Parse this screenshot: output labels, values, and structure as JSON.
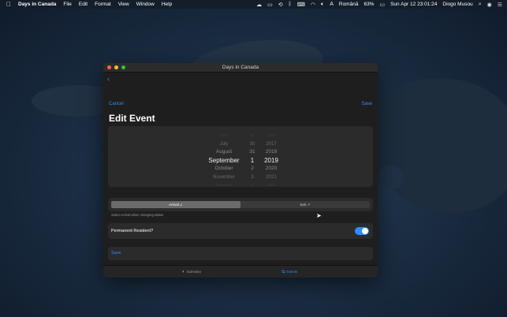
{
  "menubar": {
    "apple": "",
    "app_name": "Days in Canada",
    "menus": [
      "File",
      "Edit",
      "Format",
      "View",
      "Window",
      "Help"
    ],
    "keyboard_input": "Română",
    "battery": "63%",
    "datetime": "Sun Apr 12  23:01:24",
    "user": "Diogo Musou"
  },
  "window": {
    "title": "Days in Canada",
    "cancel_label": "Cancel",
    "save_top_label": "Save",
    "heading": "Edit Event",
    "picker": {
      "months": [
        "June",
        "July",
        "August",
        "September",
        "October",
        "November",
        "December"
      ],
      "days": [
        "29",
        "30",
        "31",
        "1",
        "2",
        "3",
        "4"
      ],
      "years": [
        "2016",
        "2017",
        "2018",
        "2019",
        "2020",
        "2021",
        "2022"
      ],
      "selected": {
        "month": "September",
        "day": "1",
        "year": "2019"
      }
    },
    "segment": {
      "arrival": "Arrival ↙",
      "exit": "Exit ↗",
      "selected": "Arrival"
    },
    "hint": "Select Arrival when changing status",
    "permanent_resident_label": "Permanent Resident?",
    "permanent_resident_on": true,
    "save_row_label": "Save",
    "tabs": {
      "summary": "Summary",
      "events": "Events",
      "active": "Events"
    }
  },
  "colors": {
    "accent": "#2f8cff",
    "window_bg": "#1e1e1e",
    "card_bg": "#2b2b2b"
  }
}
